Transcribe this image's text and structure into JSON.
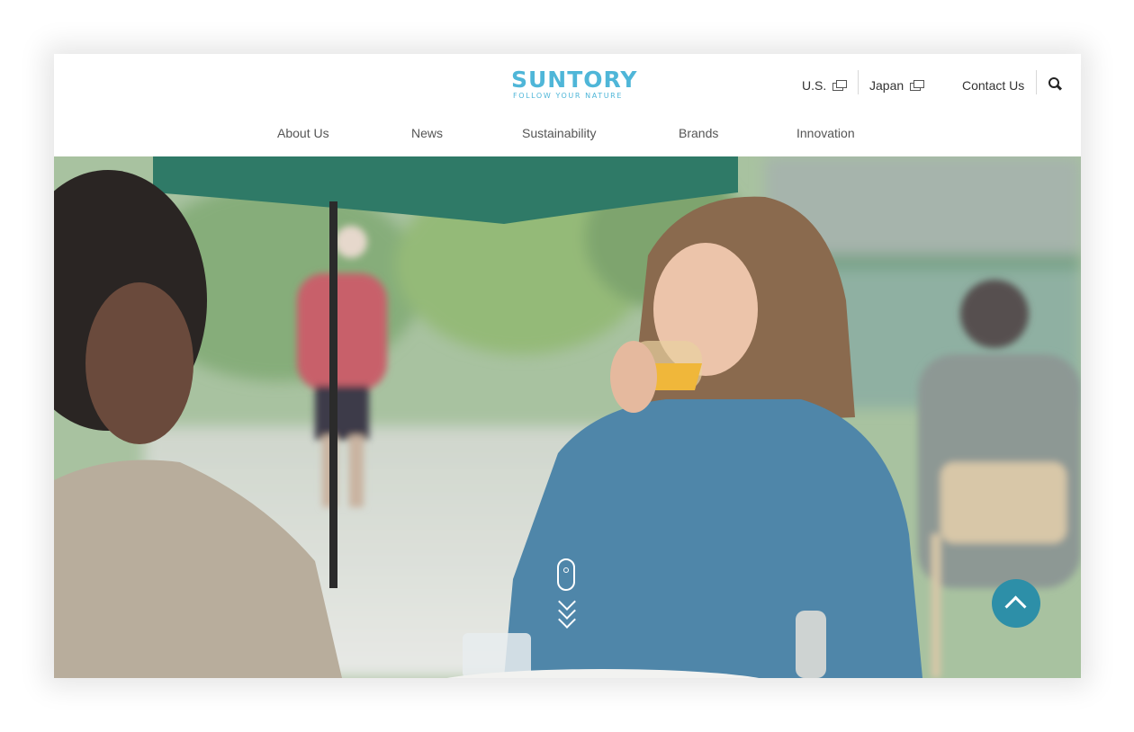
{
  "brand": {
    "name": "SUNTORY",
    "tagline": "FOLLOW YOUR NATURE",
    "color": "#4fb6d8"
  },
  "utility": {
    "us_label": "U.S.",
    "japan_label": "Japan",
    "contact_label": "Contact Us",
    "external_icon": "external-link-icon",
    "search_icon": "search-icon"
  },
  "nav": {
    "about": "About Us",
    "news": "News",
    "sustainability": "Sustainability",
    "brands": "Brands",
    "innovation": "Innovation"
  },
  "hero": {
    "scroll_icon": "mouse-scroll-icon",
    "back_to_top_icon": "chevron-up-icon",
    "back_to_top_color": "#2d8fa8"
  }
}
